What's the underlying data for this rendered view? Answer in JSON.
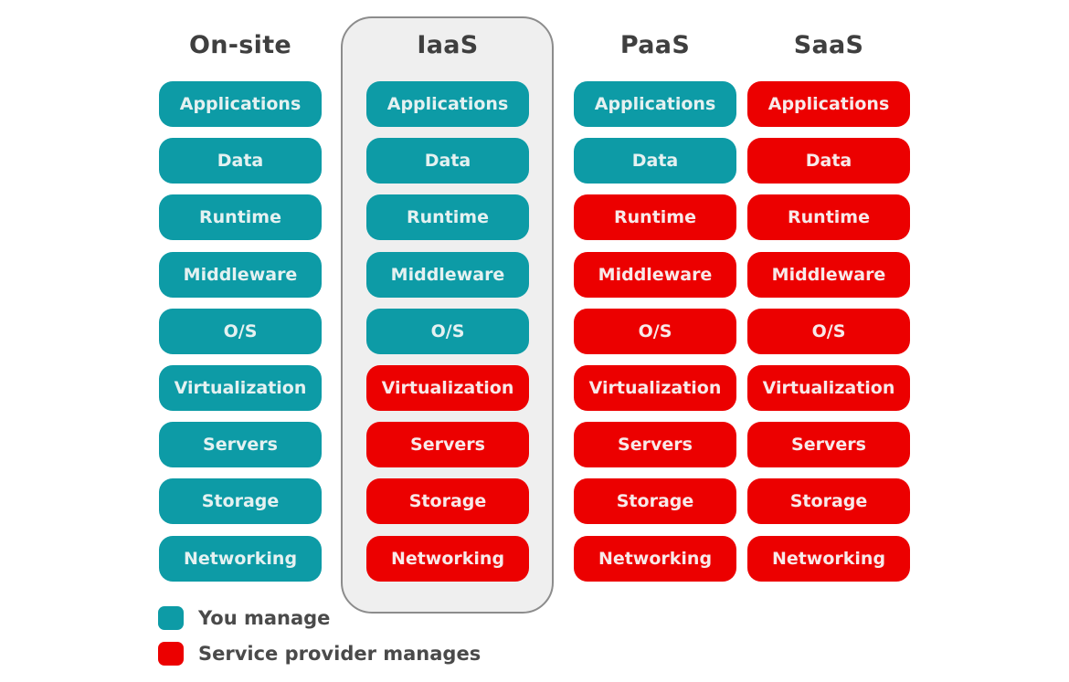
{
  "colors": {
    "you_manage": "#0d9ba6",
    "service_provider_manages": "#ec0000",
    "highlight_panel": "#efefef"
  },
  "layers": [
    "Applications",
    "Data",
    "Runtime",
    "Middleware",
    "O/S",
    "Virtualization",
    "Servers",
    "Storage",
    "Networking"
  ],
  "columns": [
    {
      "title": "On-site",
      "highlighted": false,
      "cells": [
        {
          "label": "Applications",
          "managed_by": "you"
        },
        {
          "label": "Data",
          "managed_by": "you"
        },
        {
          "label": "Runtime",
          "managed_by": "you"
        },
        {
          "label": "Middleware",
          "managed_by": "you"
        },
        {
          "label": "O/S",
          "managed_by": "you"
        },
        {
          "label": "Virtualization",
          "managed_by": "you"
        },
        {
          "label": "Servers",
          "managed_by": "you"
        },
        {
          "label": "Storage",
          "managed_by": "you"
        },
        {
          "label": "Networking",
          "managed_by": "you"
        }
      ]
    },
    {
      "title": "IaaS",
      "highlighted": true,
      "cells": [
        {
          "label": "Applications",
          "managed_by": "you"
        },
        {
          "label": "Data",
          "managed_by": "you"
        },
        {
          "label": "Runtime",
          "managed_by": "you"
        },
        {
          "label": "Middleware",
          "managed_by": "you"
        },
        {
          "label": "O/S",
          "managed_by": "you"
        },
        {
          "label": "Virtualization",
          "managed_by": "provider"
        },
        {
          "label": "Servers",
          "managed_by": "provider"
        },
        {
          "label": "Storage",
          "managed_by": "provider"
        },
        {
          "label": "Networking",
          "managed_by": "provider"
        }
      ]
    },
    {
      "title": "PaaS",
      "highlighted": false,
      "cells": [
        {
          "label": "Applications",
          "managed_by": "you"
        },
        {
          "label": "Data",
          "managed_by": "you"
        },
        {
          "label": "Runtime",
          "managed_by": "provider"
        },
        {
          "label": "Middleware",
          "managed_by": "provider"
        },
        {
          "label": "O/S",
          "managed_by": "provider"
        },
        {
          "label": "Virtualization",
          "managed_by": "provider"
        },
        {
          "label": "Servers",
          "managed_by": "provider"
        },
        {
          "label": "Storage",
          "managed_by": "provider"
        },
        {
          "label": "Networking",
          "managed_by": "provider"
        }
      ]
    },
    {
      "title": "SaaS",
      "highlighted": false,
      "cells": [
        {
          "label": "Applications",
          "managed_by": "provider"
        },
        {
          "label": "Data",
          "managed_by": "provider"
        },
        {
          "label": "Runtime",
          "managed_by": "provider"
        },
        {
          "label": "Middleware",
          "managed_by": "provider"
        },
        {
          "label": "O/S",
          "managed_by": "provider"
        },
        {
          "label": "Virtualization",
          "managed_by": "provider"
        },
        {
          "label": "Servers",
          "managed_by": "provider"
        },
        {
          "label": "Storage",
          "managed_by": "provider"
        },
        {
          "label": "Networking",
          "managed_by": "provider"
        }
      ]
    }
  ],
  "legend": [
    {
      "key": "you",
      "label": "You manage"
    },
    {
      "key": "provider",
      "label": "Service provider manages"
    }
  ]
}
